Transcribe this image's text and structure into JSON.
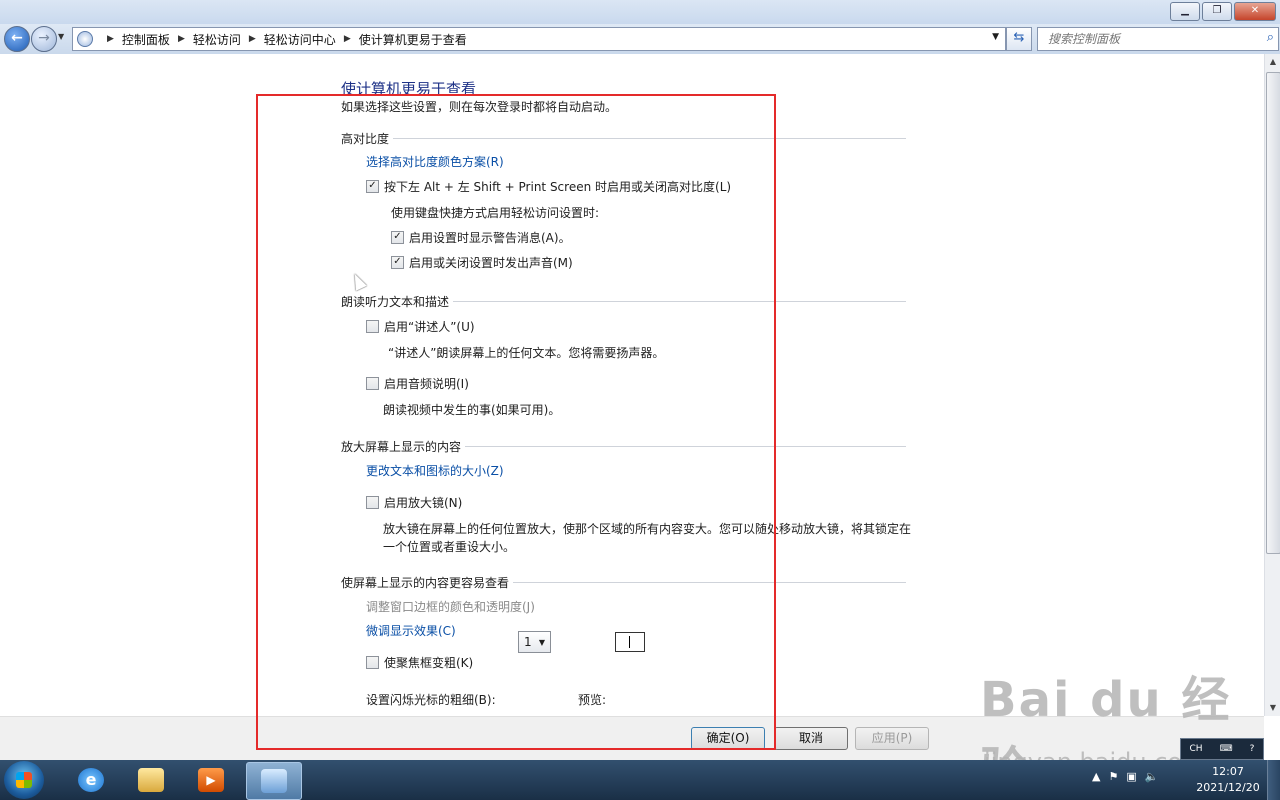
{
  "window": {
    "minimize_label": "▁",
    "maximize_label": "❐",
    "close_label": "✕"
  },
  "address": {
    "breadcrumbs": [
      "控制面板",
      "轻松访问",
      "轻松访问中心",
      "使计算机更易于查看"
    ],
    "search_placeholder": "搜索控制面板"
  },
  "page": {
    "title": "使计算机更易于查看",
    "intro": "如果选择这些设置，则在每次登录时都将自动启动。"
  },
  "high_contrast": {
    "heading": "高对比度",
    "link_choose": "选择高对比度颜色方案(R)",
    "toggle_label": "按下左 Alt + 左 Shift + Print Screen 时启用或关闭高对比度(L)",
    "toggle_checked": true,
    "shortcut_desc": "使用键盘快捷方式启用轻松访问设置时:",
    "warning_label": "启用设置时显示警告消息(A)。",
    "warning_checked": true,
    "sound_label": "启用或关闭设置时发出声音(M)",
    "sound_checked": true
  },
  "narration": {
    "heading": "朗读听力文本和描述",
    "narrator_label": "启用“讲述人”(U)",
    "narrator_checked": false,
    "narrator_desc": "“讲述人”朗读屏幕上的任何文本。您将需要扬声器。",
    "audio_desc_label": "启用音频说明(I)",
    "audio_desc_checked": false,
    "audio_desc_desc": "朗读视频中发生的事(如果可用)。"
  },
  "magnify": {
    "heading": "放大屏幕上显示的内容",
    "link_resize": "更改文本和图标的大小(Z)",
    "magnifier_label": "启用放大镜(N)",
    "magnifier_checked": false,
    "magnifier_desc_1": "放大镜在屏幕上的任何位置放大，使那个区域的所有内容变大。您可以随处移动放大镜，将其锁定在",
    "magnifier_desc_2": "一个位置或者重设大小。"
  },
  "easier_view": {
    "heading": "使屏幕上显示的内容更容易查看",
    "link_border": "调整窗口边框的颜色和透明度(J)",
    "link_tune": "微调显示效果(C)",
    "focus_label": "使聚焦框变粗(K)",
    "focus_checked": false,
    "cursor_label": "设置闪烁光标的粗细(B):",
    "cursor_value": "1",
    "preview_label": "预览:"
  },
  "footer": {
    "ok": "确定(O)",
    "cancel": "取消",
    "apply": "应用(P)"
  },
  "taskbar": {
    "lang": "CH",
    "time": "12:07",
    "date": "2021/12/20"
  },
  "watermark": {
    "logo": "Bai du 经验",
    "url": "jingyan.baidu.com"
  },
  "colors": {
    "link": "#0a4fa6",
    "title": "#1e3287",
    "annotation_box": "#e42a2a"
  }
}
